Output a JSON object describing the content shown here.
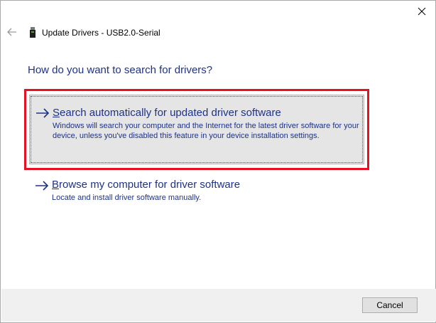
{
  "window": {
    "close_icon": "close-icon",
    "back_icon": "back-arrow-icon",
    "header_icon": "usb-device-icon",
    "title": "Update Drivers - USB2.0-Serial"
  },
  "question": "How do you want to search for drivers?",
  "options": [
    {
      "first_letter": "S",
      "title_rest": "earch automatically for updated driver software",
      "description": "Windows will search your computer and the Internet for the latest driver software for your device, unless you've disabled this feature in your device installation settings.",
      "icon": "right-arrow-icon",
      "selected": true
    },
    {
      "first_letter": "B",
      "title_rest": "rowse my computer for driver software",
      "description": "Locate and install driver software manually.",
      "icon": "right-arrow-icon",
      "selected": false
    }
  ],
  "footer": {
    "cancel_label": "Cancel"
  },
  "colors": {
    "link_blue": "#1e3287",
    "highlight_red": "#e81123",
    "selected_bg": "#e5e5e5",
    "footer_bg": "#f0f0f0"
  }
}
